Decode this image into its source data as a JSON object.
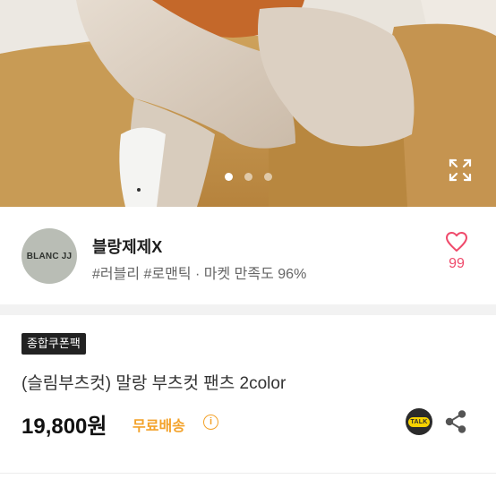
{
  "hero": {
    "icons": {
      "expand": "expand-icon"
    },
    "carousel": {
      "count": 3,
      "active": 1
    }
  },
  "seller": {
    "avatar_text": "BLANC JJ",
    "name": "블랑제제X",
    "tags": "#러블리 #로맨틱 · 마켓 만족도 96%",
    "like_count": "99",
    "colors": {
      "like": "#ef4a6b"
    }
  },
  "product": {
    "coupon_badge": "종합쿠폰팩",
    "title": "(슬림부츠컷) 말랑 부츠컷 팬츠 2color",
    "price": "19,800원",
    "shipping": "무료배송",
    "info_symbol": "i",
    "talk_label": "TALK",
    "colors": {
      "shipping": "#f3a22a",
      "talk": "#f7d300"
    }
  }
}
